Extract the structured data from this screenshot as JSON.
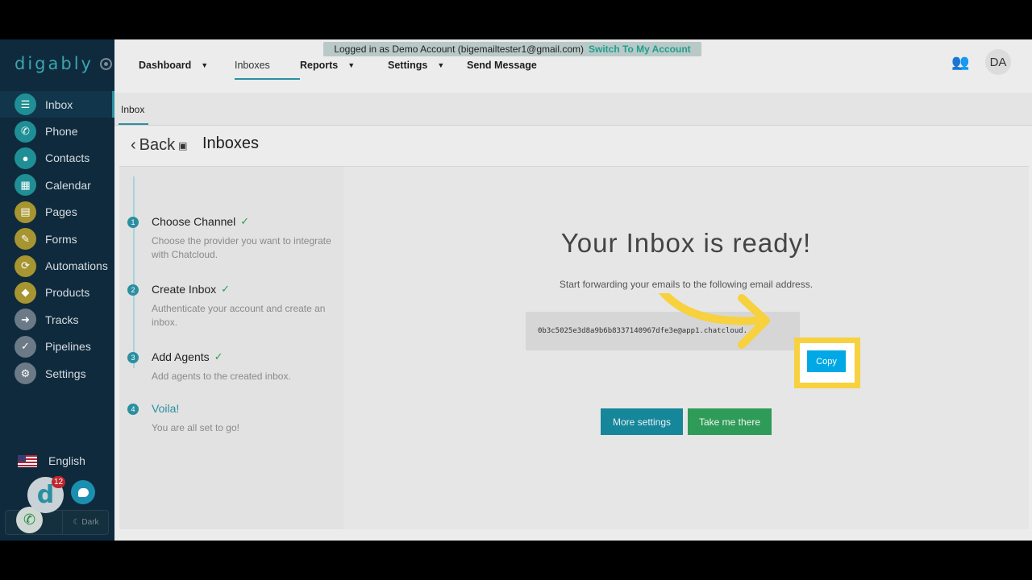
{
  "banner": {
    "text": "Logged in as Demo Account (bigemailtester1@gmail.com)",
    "link": "Switch To My Account"
  },
  "logo": "digably",
  "sidebar": {
    "items": [
      {
        "label": "Inbox",
        "icon": "inbox-icon",
        "color": "#1f8f95",
        "glyph": "☰"
      },
      {
        "label": "Phone",
        "icon": "phone-icon",
        "color": "#1f8f95",
        "glyph": "✆"
      },
      {
        "label": "Contacts",
        "icon": "person-icon",
        "color": "#1f8f95",
        "glyph": "●"
      },
      {
        "label": "Calendar",
        "icon": "calendar-icon",
        "color": "#1f8f95",
        "glyph": "▦"
      },
      {
        "label": "Pages",
        "icon": "pages-icon",
        "color": "#a69530",
        "glyph": "▤"
      },
      {
        "label": "Forms",
        "icon": "pencil-icon",
        "color": "#a69530",
        "glyph": "✎"
      },
      {
        "label": "Automations",
        "icon": "refresh-icon",
        "color": "#a69530",
        "glyph": "⟳"
      },
      {
        "label": "Products",
        "icon": "tag-icon",
        "color": "#a69530",
        "glyph": "◆"
      },
      {
        "label": "Tracks",
        "icon": "direction-icon",
        "color": "#6b7a86",
        "glyph": "➜"
      },
      {
        "label": "Pipelines",
        "icon": "check-circle-icon",
        "color": "#6b7a86",
        "glyph": "✓"
      },
      {
        "label": "Settings",
        "icon": "gear-icon",
        "color": "#6b7a86",
        "glyph": "⚙"
      }
    ],
    "language": "English",
    "dark_label": "Dark",
    "badge_count": "12"
  },
  "topnav": {
    "items": [
      {
        "label": "Dashboard",
        "caret": true
      },
      {
        "label": "Inboxes",
        "caret": false
      },
      {
        "label": "Reports",
        "caret": true
      },
      {
        "label": "Settings",
        "caret": true
      },
      {
        "label": "Send Message",
        "caret": false
      }
    ],
    "avatar": "DA"
  },
  "subtab": "Inbox",
  "header": {
    "back": "Back",
    "title": "Inboxes"
  },
  "steps": [
    {
      "num": "1",
      "title": "Choose Channel",
      "desc": "Choose the provider you want to integrate with Chatcloud.",
      "done": true
    },
    {
      "num": "2",
      "title": "Create Inbox",
      "desc": "Authenticate your account and create an inbox.",
      "done": true
    },
    {
      "num": "3",
      "title": "Add Agents",
      "desc": "Add agents to the created inbox.",
      "done": true
    },
    {
      "num": "4",
      "title": "Voila!",
      "desc": "You are all set to go!",
      "done": false
    }
  ],
  "main": {
    "title": "Your Inbox is ready!",
    "subtitle": "Start forwarding your emails to the following email address.",
    "email": "0b3c5025e3d8a9b6b8337140967dfe3e@app1.chatcloud.",
    "copy_label": "Copy",
    "more_settings": "More settings",
    "take_me_there": "Take me there"
  },
  "colors": {
    "accent": "#2a8fa0",
    "highlight": "#f7d13e",
    "copy": "#00a9e6",
    "success": "#2f9b58"
  }
}
